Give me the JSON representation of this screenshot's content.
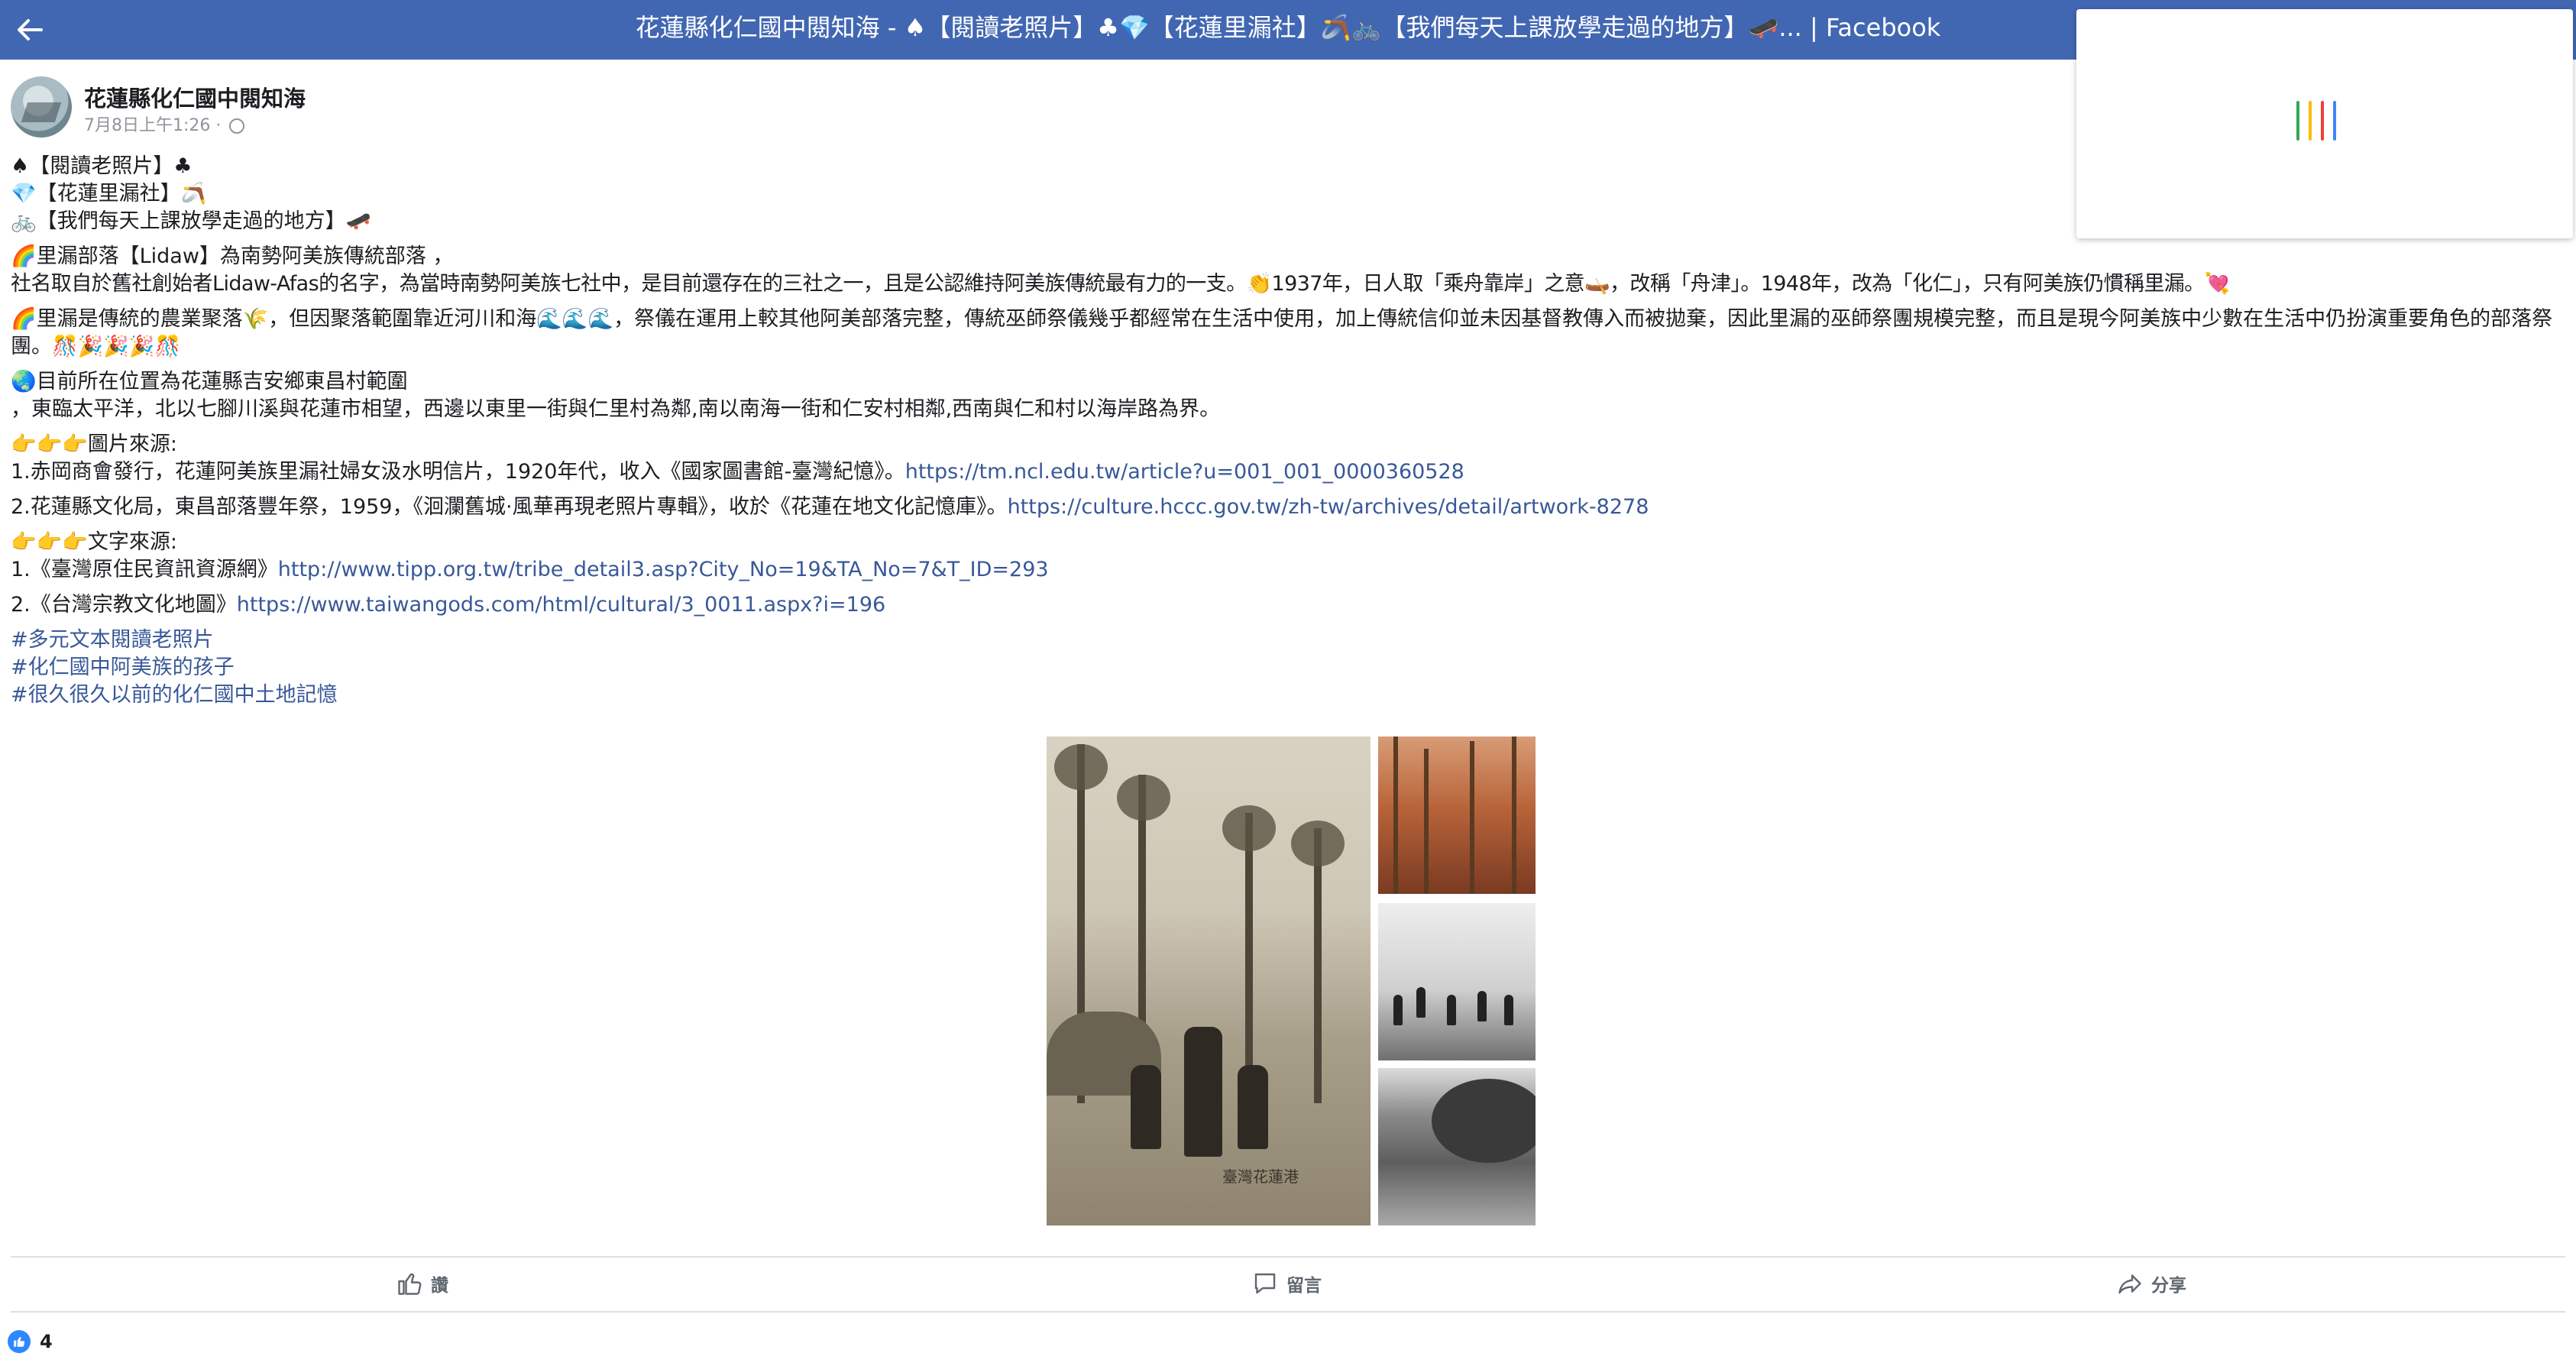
{
  "topbar": {
    "title": "花蓮縣化仁國中閱知海 - ♠【閱讀老照片】♣💎【花蓮里漏社】🪃🚲【我們每天上課放學走過的地方】🛹... | Facebook"
  },
  "post": {
    "page_name": "花蓮縣化仁國中閱知海",
    "timestamp": "7月8日上午1:26 · ",
    "lines": {
      "l1": "♠【閱讀老照片】♣",
      "l2": "💎【花蓮里漏社】🪃",
      "l3": "🚲【我們每天上課放學走過的地方】🛹",
      "l4": "🌈里漏部落【Lidaw】為南勢阿美族傳統部落 ，",
      "l5": "社名取自於舊社創始者Lidaw-Afas的名字，為當時南勢阿美族七社中，是目前還存在的三社之一，且是公認維持阿美族傳統最有力的一支。👏1937年，日人取「乘舟靠岸」之意🛶，改稱「舟津」。1948年，改為「化仁」，只有阿美族仍慣稱里漏。💘",
      "l6": "🌈里漏是傳統的農業聚落🌾，但因聚落範圍靠近河川和海🌊🌊🌊，祭儀在運用上較其他阿美部落完整，傳統巫師祭儀幾乎都經常在生活中使用，加上傳統信仰並未因基督教傳入而被拋棄，因此里漏的巫師祭團規模完整，而且是現今阿美族中少數在生活中仍扮演重要角色的部落祭團。🎊🎉🎉🎉🎊",
      "l7": "🌏目前所在位置為花蓮縣吉安鄉東昌村範圍",
      "l8": "，東臨太平洋，北以七腳川溪與花蓮市相望，西邊以東里一街與仁里村為鄰,南以南海一街和仁安村相鄰,西南與仁和村以海岸路為界。",
      "l9": "👉👉👉圖片來源:",
      "l10_text": "1.赤岡商會發行，花蓮阿美族里漏社婦女汲水明信片，1920年代，收入《國家圖書館-臺灣紀憶》。",
      "l10_link": "https://tm.ncl.edu.tw/article?u=001_001_0000360528",
      "l11_text": "2.花蓮縣文化局，東昌部落豐年祭，1959，《洄瀾舊城·風華再現老照片專輯》，收於《花蓮在地文化記憶庫》。",
      "l11_link": "https://culture.hccc.gov.tw/zh-tw/archives/detail/artwork-8278",
      "l12": "👉👉👉文字來源:",
      "l13_text": "1.《臺灣原住民資訊資源網》",
      "l13_link": "http://www.tipp.org.tw/tribe_detail3.asp?City_No=19&TA_No=7&T_ID=293",
      "l14_text": "2.《台灣宗教文化地圖》",
      "l14_link": "https://www.taiwangods.com/html/cultural/3_0011.aspx?i=196"
    },
    "hashtags": [
      "#多元文本閱讀老照片",
      "#化仁國中阿美族的孩子",
      "#很久很久以前的化仁國中土地記憶"
    ],
    "photo_caption": "臺灣花蓮港"
  },
  "actions": {
    "like_label": "讚",
    "comment_label": "留言",
    "share_label": "分享"
  },
  "reactions": {
    "count": "4"
  },
  "colors": {
    "topbar": "#4267b2",
    "link": "#385898",
    "like": "#2d88ff"
  }
}
